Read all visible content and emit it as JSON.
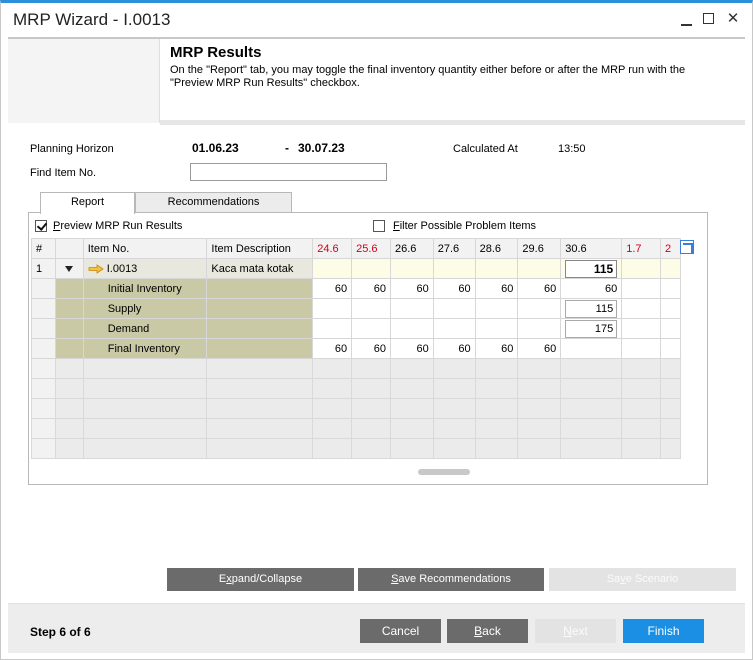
{
  "window": {
    "title": "MRP Wizard - I.0013",
    "min_glyph": "minimize",
    "max_glyph": "maximize",
    "close_glyph": "✕"
  },
  "header": {
    "title": "MRP Results",
    "description": "On the \"Report\" tab, you may toggle the final inventory quantity either before or after the MRP run with the \"Preview MRP Run Results\" checkbox."
  },
  "planning": {
    "horizon_label": "Planning Horizon",
    "horizon_from": "01.06.23",
    "horizon_sep": "-",
    "horizon_to": "30.07.23",
    "calculated_label": "Calculated At",
    "calculated_value": "13:50",
    "find_label": "Find Item No.",
    "find_value": ""
  },
  "tabs": [
    {
      "label_pre": "Rep",
      "label_ul": "o",
      "label_post": "rt",
      "active": true
    },
    {
      "label_pre": "Re",
      "label_ul": "c",
      "label_post": "ommendations",
      "active": false
    }
  ],
  "options": {
    "preview_label_ul": "P",
    "preview_label_rest": "review MRP Run Results",
    "preview_checked": true,
    "filter_label_ul": "F",
    "filter_label_rest": "ilter Possible Problem Items",
    "filter_checked": false
  },
  "grid": {
    "columns": [
      "#",
      "",
      "Item No.",
      "Item Description",
      "24.6",
      "25.6",
      "26.6",
      "27.6",
      "28.6",
      "29.6",
      "30.6",
      "1.7",
      "2"
    ],
    "red_columns": [
      4,
      5,
      11,
      12
    ],
    "item_row": {
      "num": "1",
      "item_no": "I.0013",
      "description": "Kaca mata kotak",
      "total": "115"
    },
    "sub_rows": [
      {
        "label": "Initial Inventory",
        "values": [
          "60",
          "60",
          "60",
          "60",
          "60",
          "60",
          "60"
        ],
        "boxed_last": false
      },
      {
        "label": "Supply",
        "values": [
          "",
          "",
          "",
          "",
          "",
          "",
          "115"
        ],
        "boxed_last": true
      },
      {
        "label": "Demand",
        "values": [
          "",
          "",
          "",
          "",
          "",
          "",
          "175"
        ],
        "boxed_last": true
      },
      {
        "label": "Final Inventory",
        "values": [
          "60",
          "60",
          "60",
          "60",
          "60",
          "60",
          ""
        ],
        "boxed_last": false
      }
    ]
  },
  "actions": {
    "expand_pre": "E",
    "expand_ul": "x",
    "expand_post": "pand/Collapse",
    "save_rec_ul": "S",
    "save_rec_rest": "ave Recommendations",
    "save_scn_pre": "Sa",
    "save_scn_ul": "v",
    "save_scn_post": "e Scenario"
  },
  "footer": {
    "step": "Step 6 of 6",
    "cancel": "Cancel",
    "back_ul": "B",
    "back_rest": "ack",
    "next_ul": "N",
    "next_rest": "ext",
    "finish": "Finish"
  },
  "colors": {
    "accent": "#1a8fe3",
    "title_accent": "#2b8fd9",
    "red_date": "#d0021b",
    "button_dark": "#6b6b6b",
    "subrow_bg": "#c9c9a6"
  }
}
